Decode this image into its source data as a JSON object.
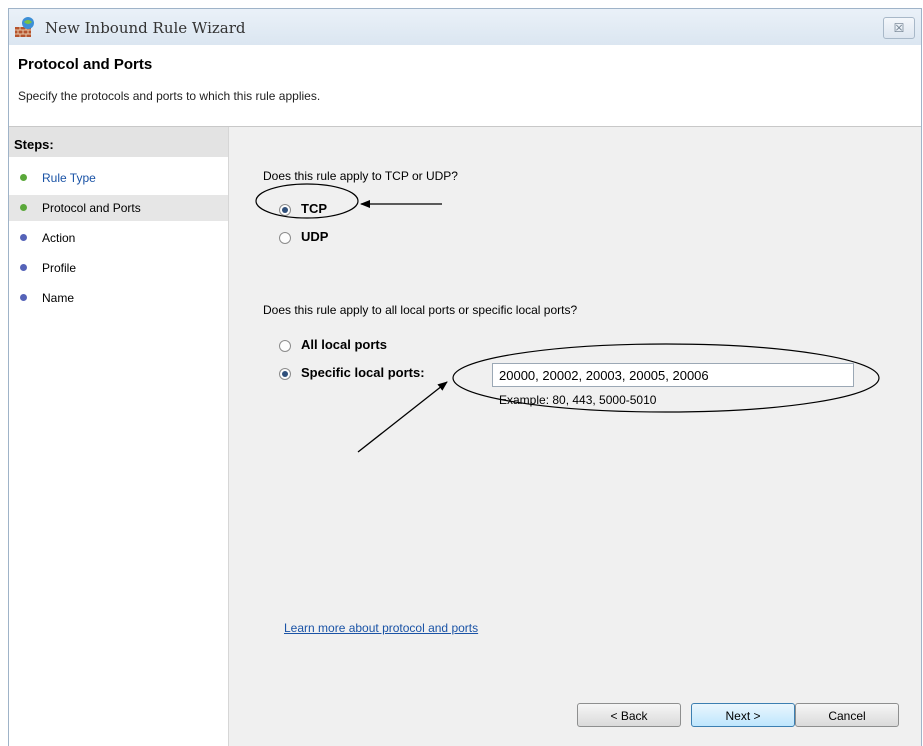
{
  "window": {
    "title": "New Inbound Rule Wizard",
    "close_label": "☒"
  },
  "header": {
    "title": "Protocol and Ports",
    "subtitle": "Specify the protocols and ports to which this rule applies."
  },
  "steps": {
    "title": "Steps:",
    "items": [
      {
        "label": "Rule Type",
        "state": "done",
        "color": "#5aa83a"
      },
      {
        "label": "Protocol and Ports",
        "state": "current",
        "color": "#5aa83a"
      },
      {
        "label": "Action",
        "state": "pending",
        "color": "#5563b8"
      },
      {
        "label": "Profile",
        "state": "pending",
        "color": "#5563b8"
      },
      {
        "label": "Name",
        "state": "pending",
        "color": "#5563b8"
      }
    ]
  },
  "protocol": {
    "question": "Does this rule apply to TCP or UDP?",
    "options": [
      {
        "label": "TCP",
        "selected": true
      },
      {
        "label": "UDP",
        "selected": false
      }
    ]
  },
  "ports": {
    "question": "Does this rule apply to all local ports or specific local ports?",
    "options": [
      {
        "label": "All local ports",
        "selected": false
      },
      {
        "label": "Specific local ports:",
        "selected": true
      }
    ],
    "value": "20000, 20002, 20003, 20005, 20006",
    "example": "Example: 80, 443, 5000-5010"
  },
  "learn_more": "Learn more about protocol and ports",
  "buttons": {
    "back": "< Back",
    "next": "Next >",
    "cancel": "Cancel"
  }
}
